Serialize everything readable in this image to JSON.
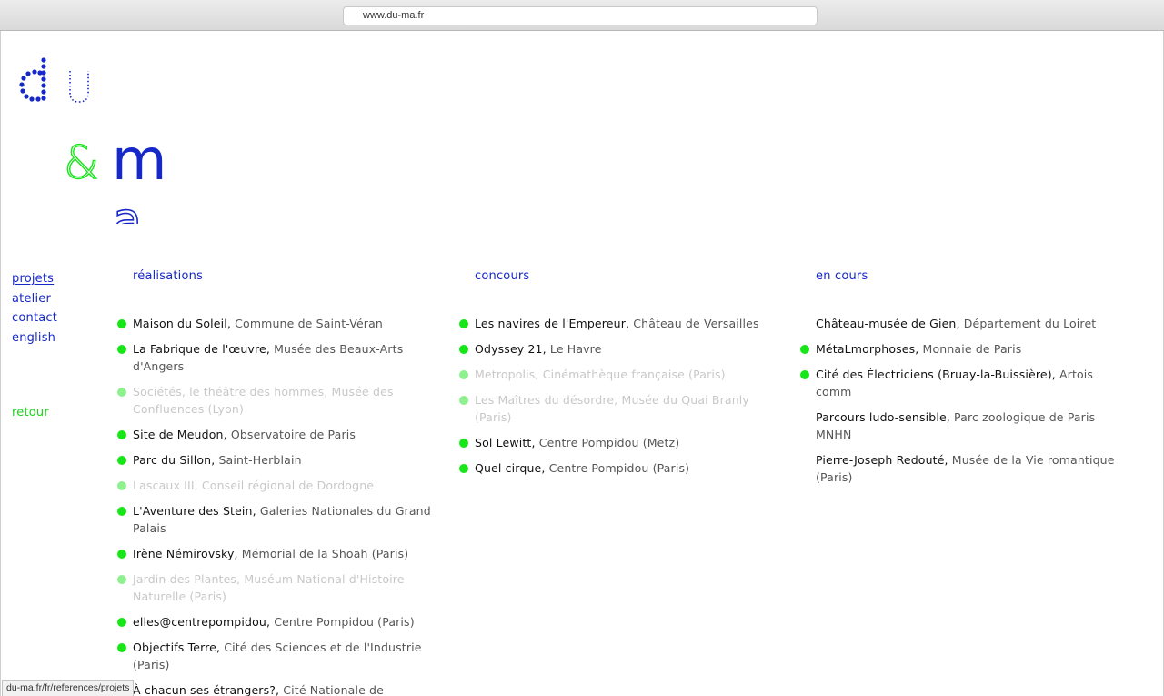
{
  "browser": {
    "url": "www.du-ma.fr",
    "status_url": "du-ma.fr/fr/references/projets"
  },
  "logo": {
    "letters": [
      "d",
      "u",
      "&",
      "m",
      "a"
    ],
    "colors": {
      "blue": "#1628c8",
      "green": "#19e619"
    }
  },
  "nav": {
    "items": [
      {
        "label": "projets",
        "active": true
      },
      {
        "label": "atelier"
      },
      {
        "label": "contact"
      },
      {
        "label": "english"
      }
    ],
    "back": "retour"
  },
  "columns": [
    {
      "heading": "réalisations",
      "items": [
        {
          "title": "Maison du Soleil,",
          "sub": "Commune de Saint-Véran",
          "dot": true
        },
        {
          "title": "La Fabrique de l'œuvre,",
          "sub": "Musée des Beaux-Arts d'Angers",
          "dot": true
        },
        {
          "title": "Sociétés, le théâtre des hommes,",
          "sub": "Musée des Confluences (Lyon)",
          "dot": true,
          "dim": true
        },
        {
          "title": "Site de Meudon,",
          "sub": "Observatoire de Paris",
          "dot": true
        },
        {
          "title": "Parc du Sillon,",
          "sub": "Saint-Herblain",
          "dot": true
        },
        {
          "title": "Lascaux III,",
          "sub": "Conseil régional de Dordogne",
          "dot": true,
          "dim": true
        },
        {
          "title": "L'Aventure des Stein,",
          "sub": "Galeries Nationales du Grand Palais",
          "dot": true
        },
        {
          "title": "Irène Némirovsky,",
          "sub": "Mémorial de la Shoah (Paris)",
          "dot": true
        },
        {
          "title": "Jardin des Plantes,",
          "sub": "Muséum National d'Histoire Naturelle (Paris)",
          "dot": true,
          "dim": true
        },
        {
          "title": "elles@centrepompidou,",
          "sub": "Centre Pompidou (Paris)",
          "dot": true
        },
        {
          "title": "Objectifs Terre,",
          "sub": "Cité des Sciences et de l'Industrie (Paris)",
          "dot": true
        },
        {
          "title": "À chacun ses étrangers?,",
          "sub": "Cité Nationale de l'Histoire",
          "dot": true
        }
      ]
    },
    {
      "heading": "concours",
      "items": [
        {
          "title": "Les navires de l'Empereur,",
          "sub": "Château de Versailles",
          "dot": true
        },
        {
          "title": "Odyssey 21,",
          "sub": "Le Havre",
          "dot": true
        },
        {
          "title": "Metropolis,",
          "sub": "Cinémathèque française (Paris)",
          "dot": true,
          "dim": true
        },
        {
          "title": "Les Maîtres du désordre,",
          "sub": "Musée du Quai Branly (Paris)",
          "dot": true,
          "dim": true
        },
        {
          "title": "Sol Lewitt,",
          "sub": "Centre Pompidou (Metz)",
          "dot": true
        },
        {
          "title": "Quel cirque,",
          "sub": "Centre Pompidou (Paris)",
          "dot": true
        }
      ]
    },
    {
      "heading": "en cours",
      "items": [
        {
          "title": "Château-musée de Gien,",
          "sub": "Département du Loiret",
          "dot": false
        },
        {
          "title": "MétaLmorphoses,",
          "sub": "Monnaie de Paris",
          "dot": true
        },
        {
          "title": "Cité des Électriciens (Bruay-la-Buissière),",
          "sub": "Artois comm",
          "dot": true
        },
        {
          "title": "Parcours ludo-sensible,",
          "sub": "Parc zoologique de Paris MNHN",
          "dot": false
        },
        {
          "title": "Pierre-Joseph Redouté,",
          "sub": "Musée de la Vie romantique (Paris)",
          "dot": false
        }
      ]
    }
  ]
}
